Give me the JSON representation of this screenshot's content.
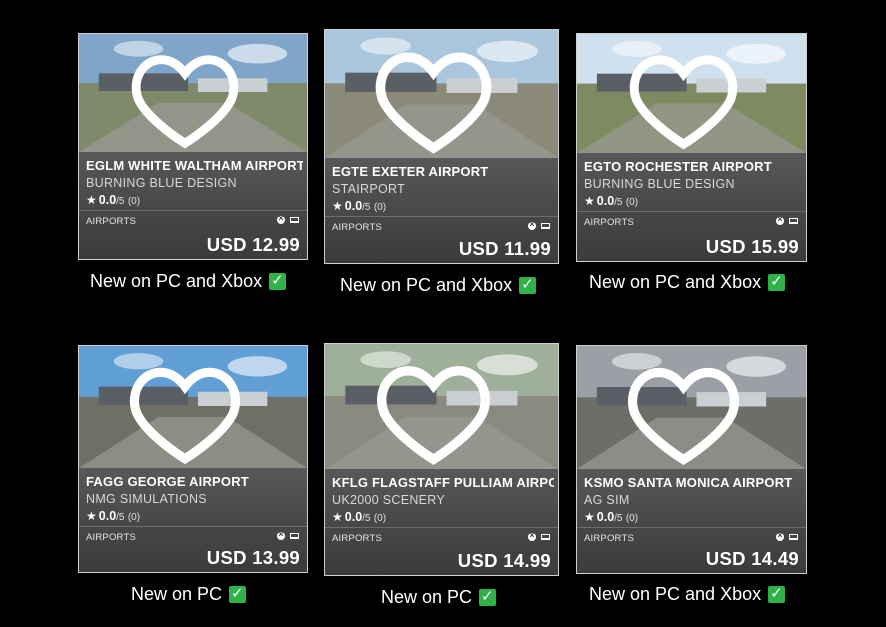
{
  "cards": [
    {
      "title": "EGLM WHITE WALTHAM AIRPORT",
      "publisher": "BURNING BLUE DESIGN",
      "rating": "0.0",
      "rating_scale": "/5",
      "rating_count": "(0)",
      "category": "AIRPORTS",
      "price": "USD 12.99",
      "caption": "New on PC and Xbox",
      "sky": "#7fa6c9",
      "ground": "#7f8a6a"
    },
    {
      "title": "EGTE EXETER AIRPORT",
      "publisher": "STAIRPORT",
      "rating": "0.0",
      "rating_scale": "/5",
      "rating_count": "(0)",
      "category": "AIRPORTS",
      "price": "USD 11.99",
      "caption": "New on PC and Xbox",
      "sky": "#a9c6dd",
      "ground": "#8b8a78"
    },
    {
      "title": "EGTO ROCHESTER AIRPORT",
      "publisher": "BURNING BLUE DESIGN",
      "rating": "0.0",
      "rating_scale": "/5",
      "rating_count": "(0)",
      "category": "AIRPORTS",
      "price": "USD 15.99",
      "caption": "New on PC and Xbox",
      "sky": "#cfe0ee",
      "ground": "#7e8a60"
    },
    {
      "title": "FAGG GEORGE AIRPORT",
      "publisher": "NMG SIMULATIONS",
      "rating": "0.0",
      "rating_scale": "/5",
      "rating_count": "(0)",
      "category": "AIRPORTS",
      "price": "USD 13.99",
      "caption": "New on PC",
      "sky": "#5f9fd6",
      "ground": "#6f6f66"
    },
    {
      "title": "KFLG FLAGSTAFF PULLIAM AIRPOI",
      "publisher": "UK2000 SCENERY",
      "rating": "0.0",
      "rating_scale": "/5",
      "rating_count": "(0)",
      "category": "AIRPORTS",
      "price": "USD 14.99",
      "caption": "New on PC",
      "sky": "#9fb09a",
      "ground": "#8a8a80"
    },
    {
      "title": "KSMO SANTA MONICA AIRPORT",
      "publisher": "AG SIM",
      "rating": "0.0",
      "rating_scale": "/5",
      "rating_count": "(0)",
      "category": "AIRPORTS",
      "price": "USD 14.49",
      "caption": "New on PC and Xbox",
      "sky": "#9aa0a6",
      "ground": "#6c6f68"
    }
  ],
  "colors": {
    "check": "#2fb24a",
    "background": "#000000"
  }
}
